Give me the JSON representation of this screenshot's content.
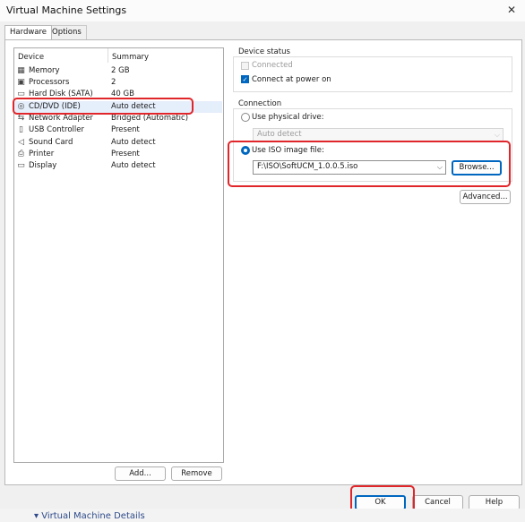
{
  "window": {
    "title": "Virtual Machine Settings",
    "close_glyph": "✕"
  },
  "tabs": [
    {
      "label": "Hardware"
    },
    {
      "label": "Options"
    }
  ],
  "device_list": {
    "col_device": "Device",
    "col_summary": "Summary",
    "items": [
      {
        "icon": "memory-icon",
        "glyph": "▦",
        "device": "Memory",
        "summary": "2 GB"
      },
      {
        "icon": "processor-icon",
        "glyph": "▣",
        "device": "Processors",
        "summary": "2"
      },
      {
        "icon": "hard-disk-icon",
        "glyph": "▭",
        "device": "Hard Disk (SATA)",
        "summary": "40 GB"
      },
      {
        "icon": "cd-dvd-icon",
        "glyph": "◎",
        "device": "CD/DVD (IDE)",
        "summary": "Auto detect"
      },
      {
        "icon": "network-adapter-icon",
        "glyph": "⇆",
        "device": "Network Adapter",
        "summary": "Bridged (Automatic)"
      },
      {
        "icon": "usb-controller-icon",
        "glyph": "▯",
        "device": "USB Controller",
        "summary": "Present"
      },
      {
        "icon": "sound-card-icon",
        "glyph": "◁",
        "device": "Sound Card",
        "summary": "Auto detect"
      },
      {
        "icon": "printer-icon",
        "glyph": "⎙",
        "device": "Printer",
        "summary": "Present"
      },
      {
        "icon": "display-icon",
        "glyph": "▭",
        "device": "Display",
        "summary": "Auto detect"
      }
    ],
    "add_label": "Add...",
    "remove_label": "Remove"
  },
  "device_status": {
    "title": "Device status",
    "connected_label": "Connected",
    "connected_checked": false,
    "connect_power_label": "Connect at power on",
    "connect_power_checked": true
  },
  "connection": {
    "title": "Connection",
    "physical_label": "Use physical drive:",
    "physical_value": "Auto detect",
    "iso_label": "Use ISO image file:",
    "iso_value": "F:\\ISO\\SoftUCM_1.0.0.5.iso",
    "browse_label": "Browse...",
    "advanced_label": "Advanced..."
  },
  "footer": {
    "ok_label": "OK",
    "cancel_label": "Cancel",
    "help_label": "Help"
  },
  "background": {
    "text": "▾ Virtual Machine Details"
  },
  "colors": {
    "accent": "#0067c0",
    "annotation": "#e0262a",
    "selection": "#e5eefb"
  }
}
